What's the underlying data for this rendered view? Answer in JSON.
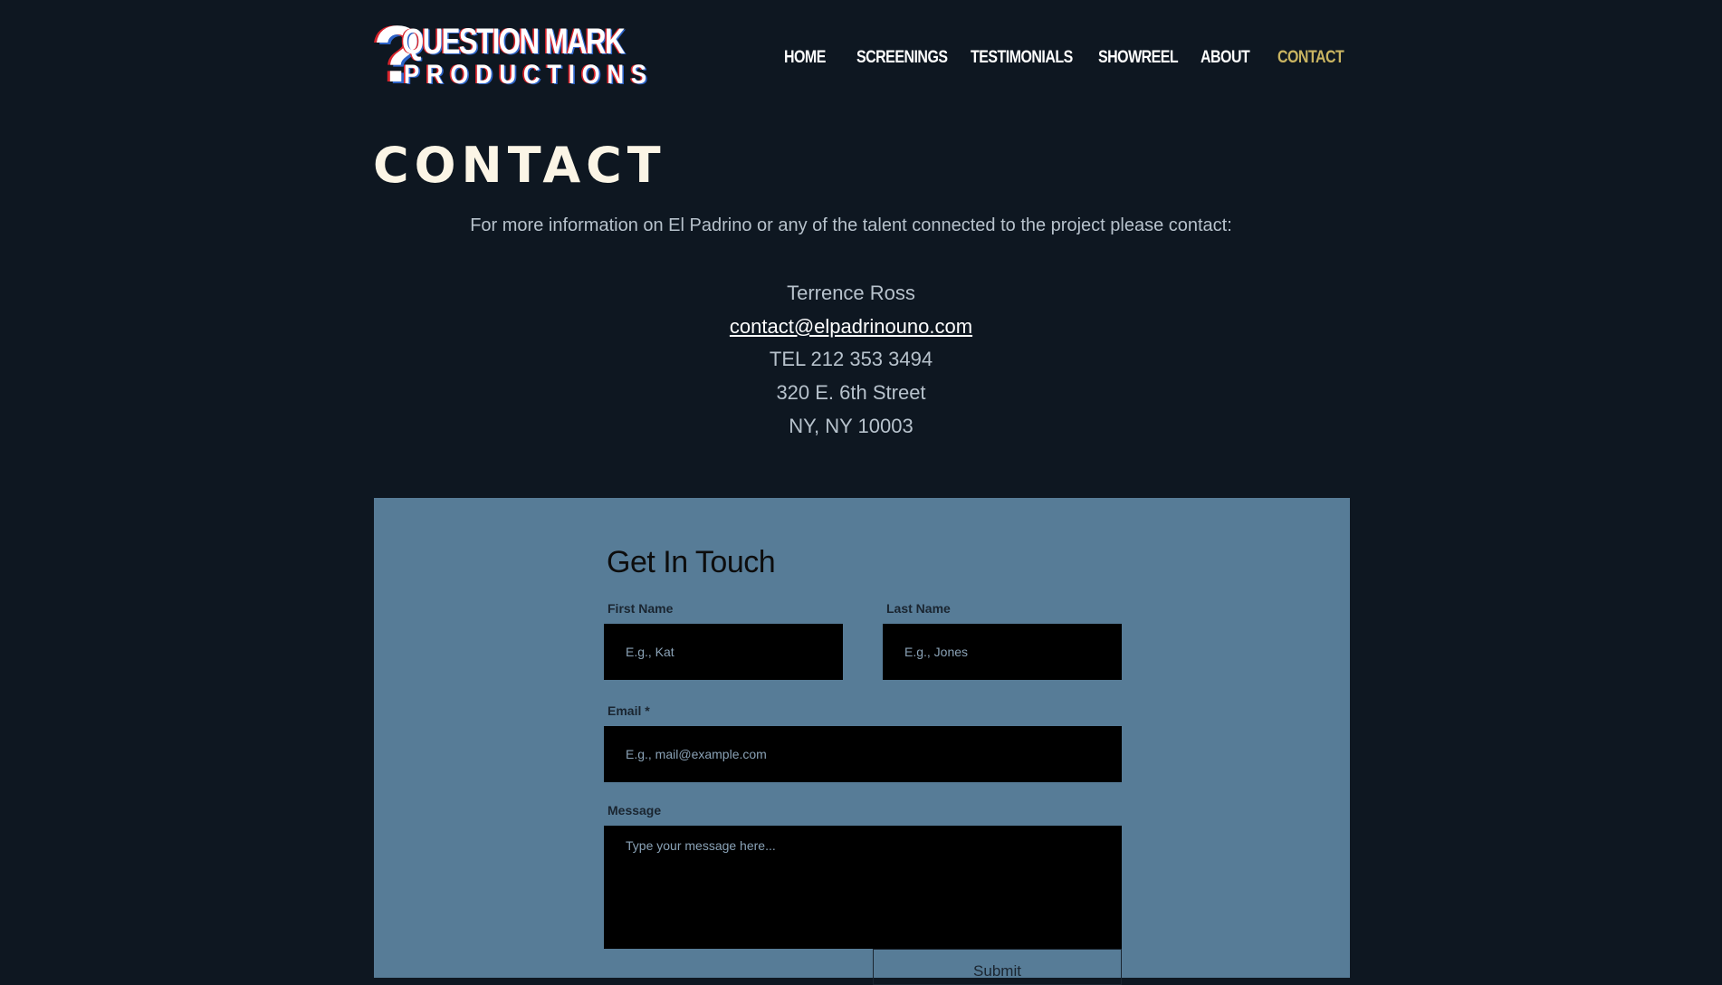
{
  "header": {
    "logo": {
      "mark": "?",
      "line1": "QUESTION MARK",
      "line2": "PRODUCTIONS"
    },
    "nav": [
      {
        "label": "HOME",
        "active": false
      },
      {
        "label": "SCREENINGS",
        "active": false
      },
      {
        "label": "TESTIMONIALS",
        "active": false
      },
      {
        "label": "SHOWREEL",
        "active": false
      },
      {
        "label": "ABOUT",
        "active": false
      },
      {
        "label": "CONTACT",
        "active": true
      }
    ]
  },
  "contact": {
    "title": "CONTACT",
    "intro": "For more information on El Padrino or any of the talent connected to the project please contact:",
    "name": "Terrence Ross",
    "email": "contact@elpadrinouno.com",
    "phone": "TEL 212 353 3494",
    "address_line1": "320 E. 6th Street",
    "address_line2": "NY, NY 10003"
  },
  "form": {
    "title": "Get In Touch",
    "first_name": {
      "label": "First Name",
      "placeholder": "E.g., Kat",
      "value": ""
    },
    "last_name": {
      "label": "Last Name",
      "placeholder": "E.g., Jones",
      "value": ""
    },
    "email": {
      "label": "Email *",
      "placeholder": "E.g., mail@example.com",
      "value": ""
    },
    "message": {
      "label": "Message",
      "placeholder": "Type your message here...",
      "value": ""
    },
    "submit_label": "Submit"
  },
  "colors": {
    "page_background": "#0e1721",
    "nav_active": "#c9b461",
    "form_panel": "#577c97",
    "field_background": "#000000"
  }
}
